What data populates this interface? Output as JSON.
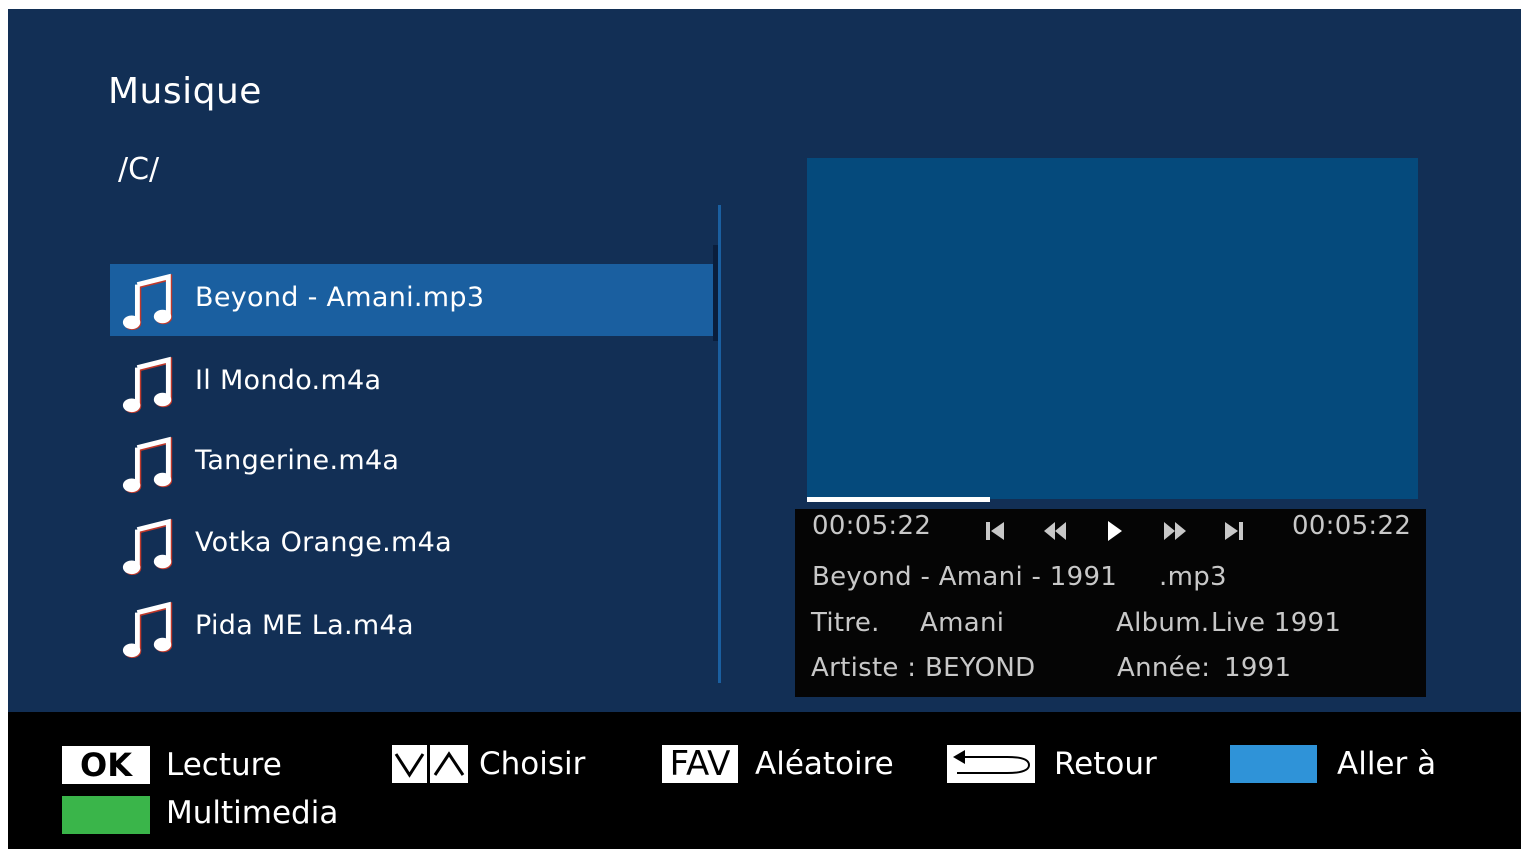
{
  "header": {
    "title": "Musique",
    "path": "/C/"
  },
  "file_list": {
    "selected_index": 0,
    "items": [
      {
        "name": "Beyond - Amani.mp3",
        "icon": "music-note-icon"
      },
      {
        "name": "Il Mondo.m4a",
        "icon": "music-note-icon"
      },
      {
        "name": "Tangerine.m4a",
        "icon": "music-note-icon"
      },
      {
        "name": "Votka Orange.m4a",
        "icon": "music-note-icon"
      },
      {
        "name": "Pida ME La.m4a",
        "icon": "music-note-icon"
      }
    ]
  },
  "player": {
    "elapsed": "00:05:22",
    "total": "00:05:22",
    "progress_fraction": 0.3,
    "controls": [
      "skip-previous-icon",
      "rewind-icon",
      "play-icon",
      "fast-forward-icon",
      "skip-next-icon"
    ],
    "now_playing": "Beyond - Amani - 1991",
    "format": ".mp3",
    "title_label": "Titre.",
    "title_value": "Amani",
    "album_label": "Album.",
    "album_value": "Live 1991",
    "artist_label": "Artiste :",
    "artist_value": "BEYOND",
    "year_label": "Année:",
    "year_value": "1991"
  },
  "footer": {
    "ok_key": "OK",
    "ok_label": "Lecture",
    "updown_label": "Choisir",
    "fav_key": "FAV",
    "fav_label": "Aléatoire",
    "return_label": "Retour",
    "blue_label": "Aller à",
    "green_label": "Multimedia"
  },
  "colors": {
    "background": "#122f55",
    "selection": "#1a5fa0",
    "preview": "#054a7c",
    "blue_key": "#2f93d8",
    "green_key": "#3ab54a"
  }
}
